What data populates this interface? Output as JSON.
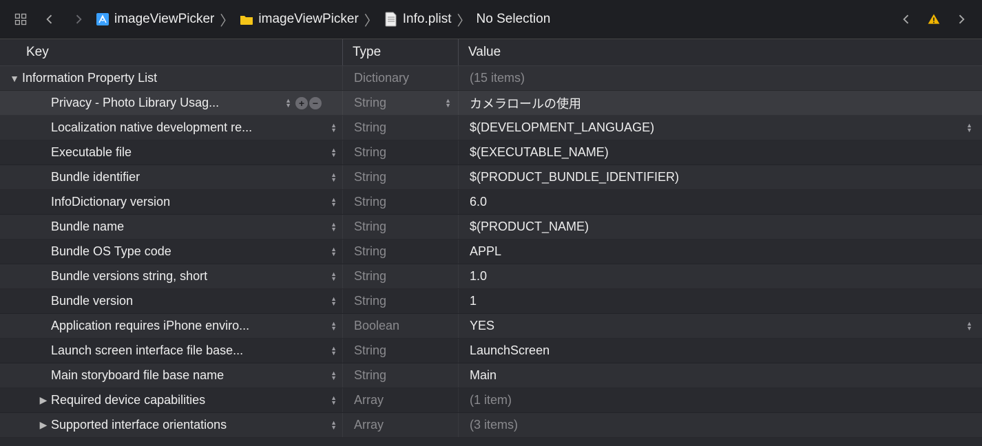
{
  "breadcrumb": [
    {
      "icon": "xcode-proj",
      "label": "imageViewPicker"
    },
    {
      "icon": "folder",
      "label": "imageViewPicker"
    },
    {
      "icon": "plist-file",
      "label": "Info.plist"
    },
    {
      "icon": "",
      "label": "No Selection"
    }
  ],
  "columns": {
    "key": "Key",
    "type": "Type",
    "value": "Value"
  },
  "root": {
    "key": "Information Property List",
    "type": "Dictionary",
    "value": "(15 items)"
  },
  "rows": [
    {
      "key": "Privacy - Photo Library Usag...",
      "type": "String",
      "value": "カメラロールの使用",
      "selected": true,
      "hasAddRemove": true,
      "hasTypeStepper": true
    },
    {
      "key": "Localization native development re...",
      "type": "String",
      "value": "$(DEVELOPMENT_LANGUAGE)",
      "hasValueStepper": true
    },
    {
      "key": "Executable file",
      "type": "String",
      "value": "$(EXECUTABLE_NAME)"
    },
    {
      "key": "Bundle identifier",
      "type": "String",
      "value": "$(PRODUCT_BUNDLE_IDENTIFIER)"
    },
    {
      "key": "InfoDictionary version",
      "type": "String",
      "value": "6.0"
    },
    {
      "key": "Bundle name",
      "type": "String",
      "value": "$(PRODUCT_NAME)"
    },
    {
      "key": "Bundle OS Type code",
      "type": "String",
      "value": "APPL"
    },
    {
      "key": "Bundle versions string, short",
      "type": "String",
      "value": "1.0"
    },
    {
      "key": "Bundle version",
      "type": "String",
      "value": "1"
    },
    {
      "key": "Application requires iPhone enviro...",
      "type": "Boolean",
      "value": "YES",
      "hasValueStepper": true
    },
    {
      "key": "Launch screen interface file base...",
      "type": "String",
      "value": "LaunchScreen"
    },
    {
      "key": "Main storyboard file base name",
      "type": "String",
      "value": "Main"
    },
    {
      "key": "Required device capabilities",
      "type": "Array",
      "value": "(1 item)",
      "hasDisclosure": true,
      "dimValue": true
    },
    {
      "key": "Supported interface orientations",
      "type": "Array",
      "value": "(3 items)",
      "hasDisclosure": true,
      "dimValue": true
    }
  ]
}
